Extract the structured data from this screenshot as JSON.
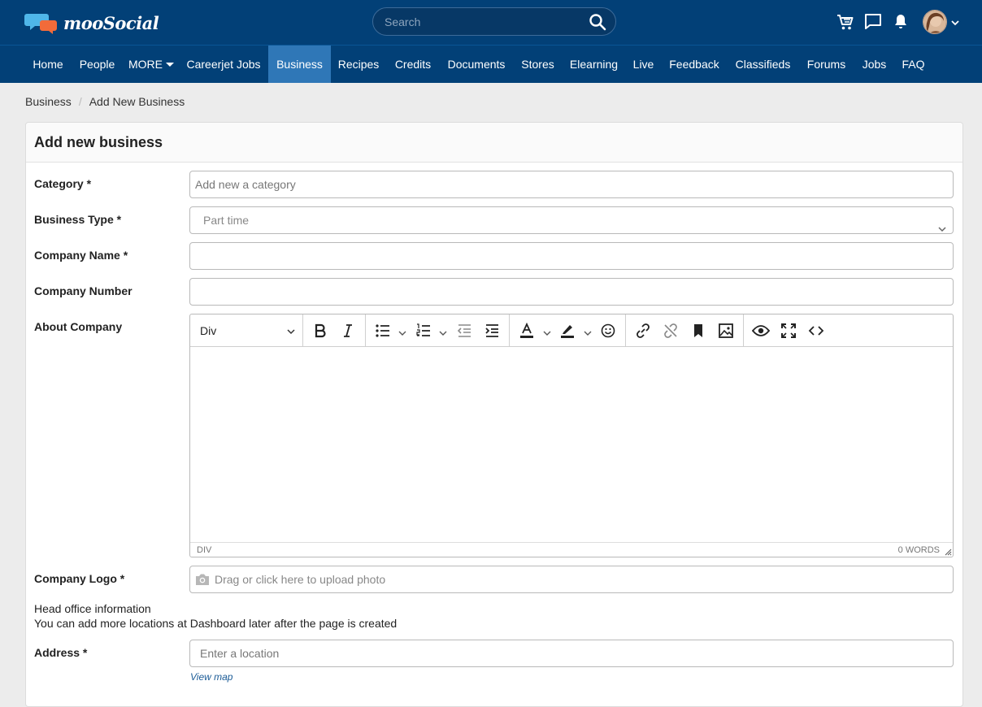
{
  "brand": {
    "name": "mooSocial"
  },
  "search": {
    "placeholder": "Search"
  },
  "header_icons": [
    "cart-icon",
    "chat-icon",
    "bell-icon",
    "avatar",
    "chevron-down-icon"
  ],
  "nav": {
    "items": [
      {
        "label": "Home"
      },
      {
        "label": "People"
      },
      {
        "label": "MORE"
      },
      {
        "label": "Careerjet Jobs"
      },
      {
        "label": "Business"
      },
      {
        "label": "Recipes"
      },
      {
        "label": "Credits"
      },
      {
        "label": "Documents"
      },
      {
        "label": "Stores"
      },
      {
        "label": "Elearning"
      },
      {
        "label": "Live"
      },
      {
        "label": "Feedback"
      },
      {
        "label": "Classifieds"
      },
      {
        "label": "Forums"
      },
      {
        "label": "Jobs"
      },
      {
        "label": "FAQ"
      }
    ],
    "active": "Business"
  },
  "breadcrumb": {
    "items": [
      "Business",
      "Add New Business"
    ]
  },
  "form": {
    "title": "Add new business",
    "category": {
      "label": "Category *",
      "placeholder": "Add new a category"
    },
    "business_type": {
      "label": "Business Type *",
      "value": "Part time"
    },
    "company_name": {
      "label": "Company Name *",
      "value": ""
    },
    "company_number": {
      "label": "Company Number",
      "value": ""
    },
    "about": {
      "label": "About Company",
      "block_format": "Div",
      "status_path": "DIV",
      "word_count": "0 WORDS"
    },
    "logo": {
      "label": "Company Logo *",
      "placeholder": "Drag or click here to upload photo"
    },
    "head_office": {
      "title": "Head office information",
      "note": "You can add more locations at Dashboard later after the page is created"
    },
    "address": {
      "label": "Address *",
      "placeholder": "Enter a location",
      "view_map": "View map"
    }
  },
  "colors": {
    "header_bg": "#024077",
    "active_nav": "#2f77b7",
    "page_bg": "#ececec",
    "link": "#1c5c97"
  }
}
